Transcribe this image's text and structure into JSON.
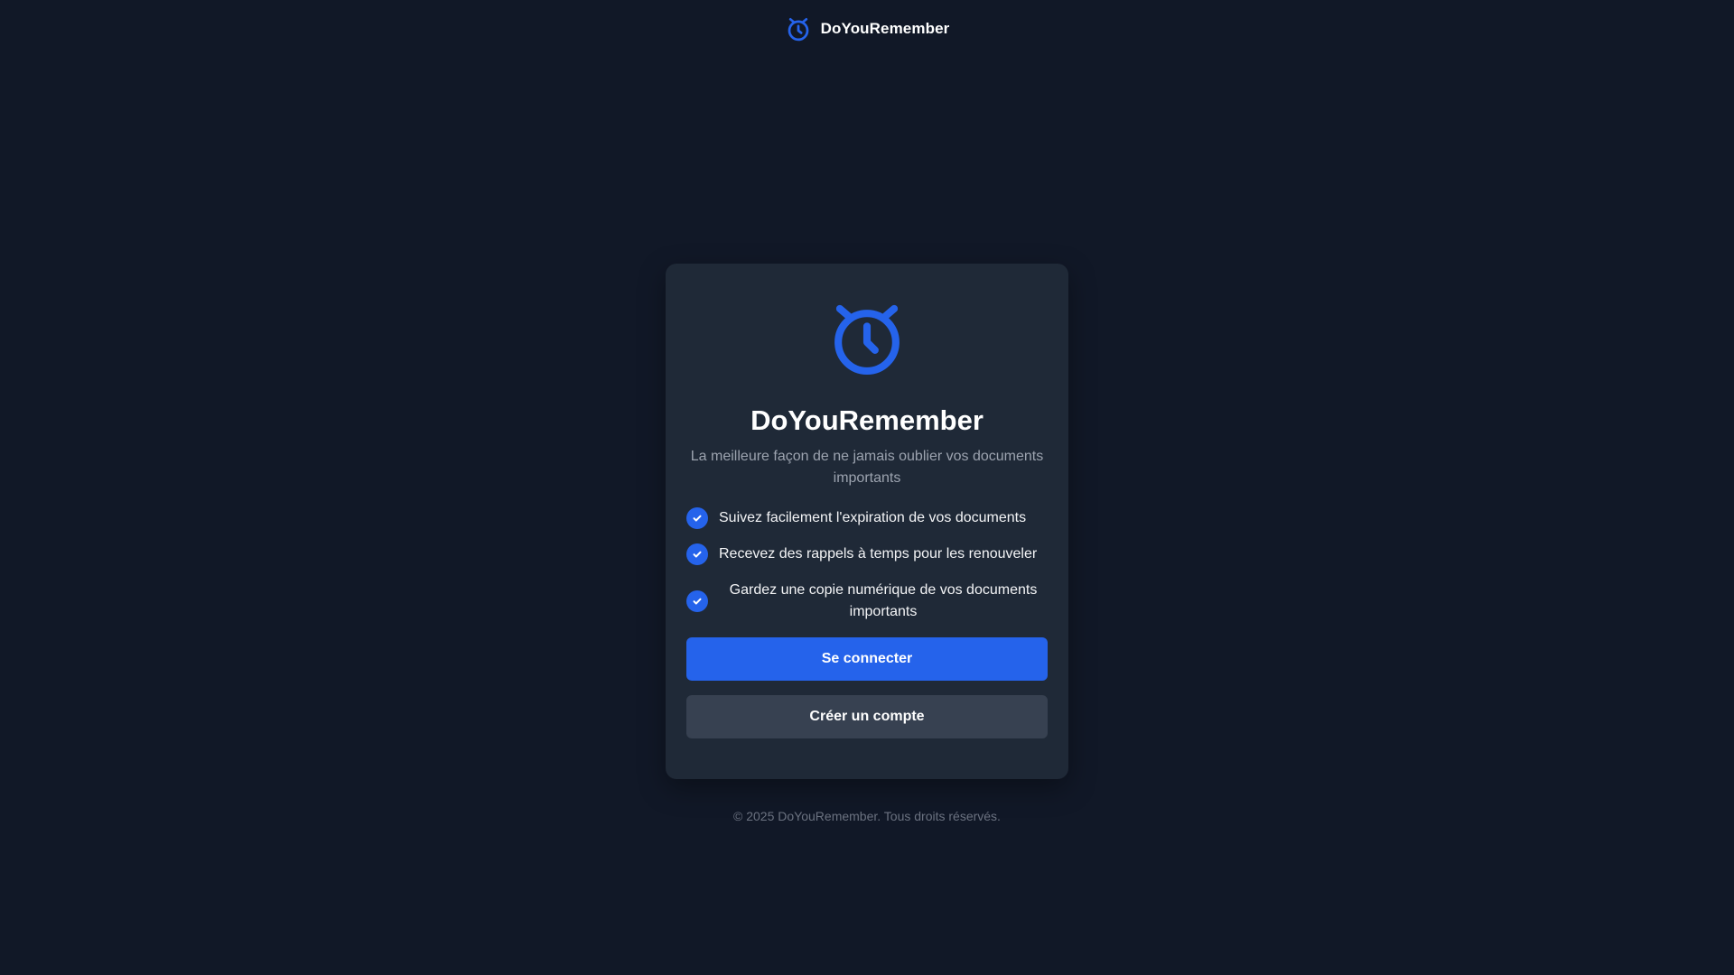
{
  "header": {
    "brand_name": "DoYouRemember",
    "logo_icon": "alarm-clock-icon"
  },
  "card": {
    "icon": "alarm-clock-icon",
    "title": "DoYouRemember",
    "subtitle": "La meilleure façon de ne jamais oublier vos documents importants",
    "features": [
      {
        "icon": "check-icon",
        "text": "Suivez facilement l'expiration de vos documents"
      },
      {
        "icon": "check-icon",
        "text": "Recevez des rappels à temps pour les renouveler"
      },
      {
        "icon": "check-icon",
        "text": "Gardez une copie numérique de vos documents importants"
      }
    ],
    "login_label": "Se connecter",
    "signup_label": "Créer un compte"
  },
  "footer": {
    "copyright": "© 2025 DoYouRemember. Tous droits réservés."
  },
  "colors": {
    "background": "#111827",
    "card": "#1f2937",
    "accent": "#2563eb",
    "secondary_button": "#374151",
    "muted_text": "#9ca3af"
  }
}
